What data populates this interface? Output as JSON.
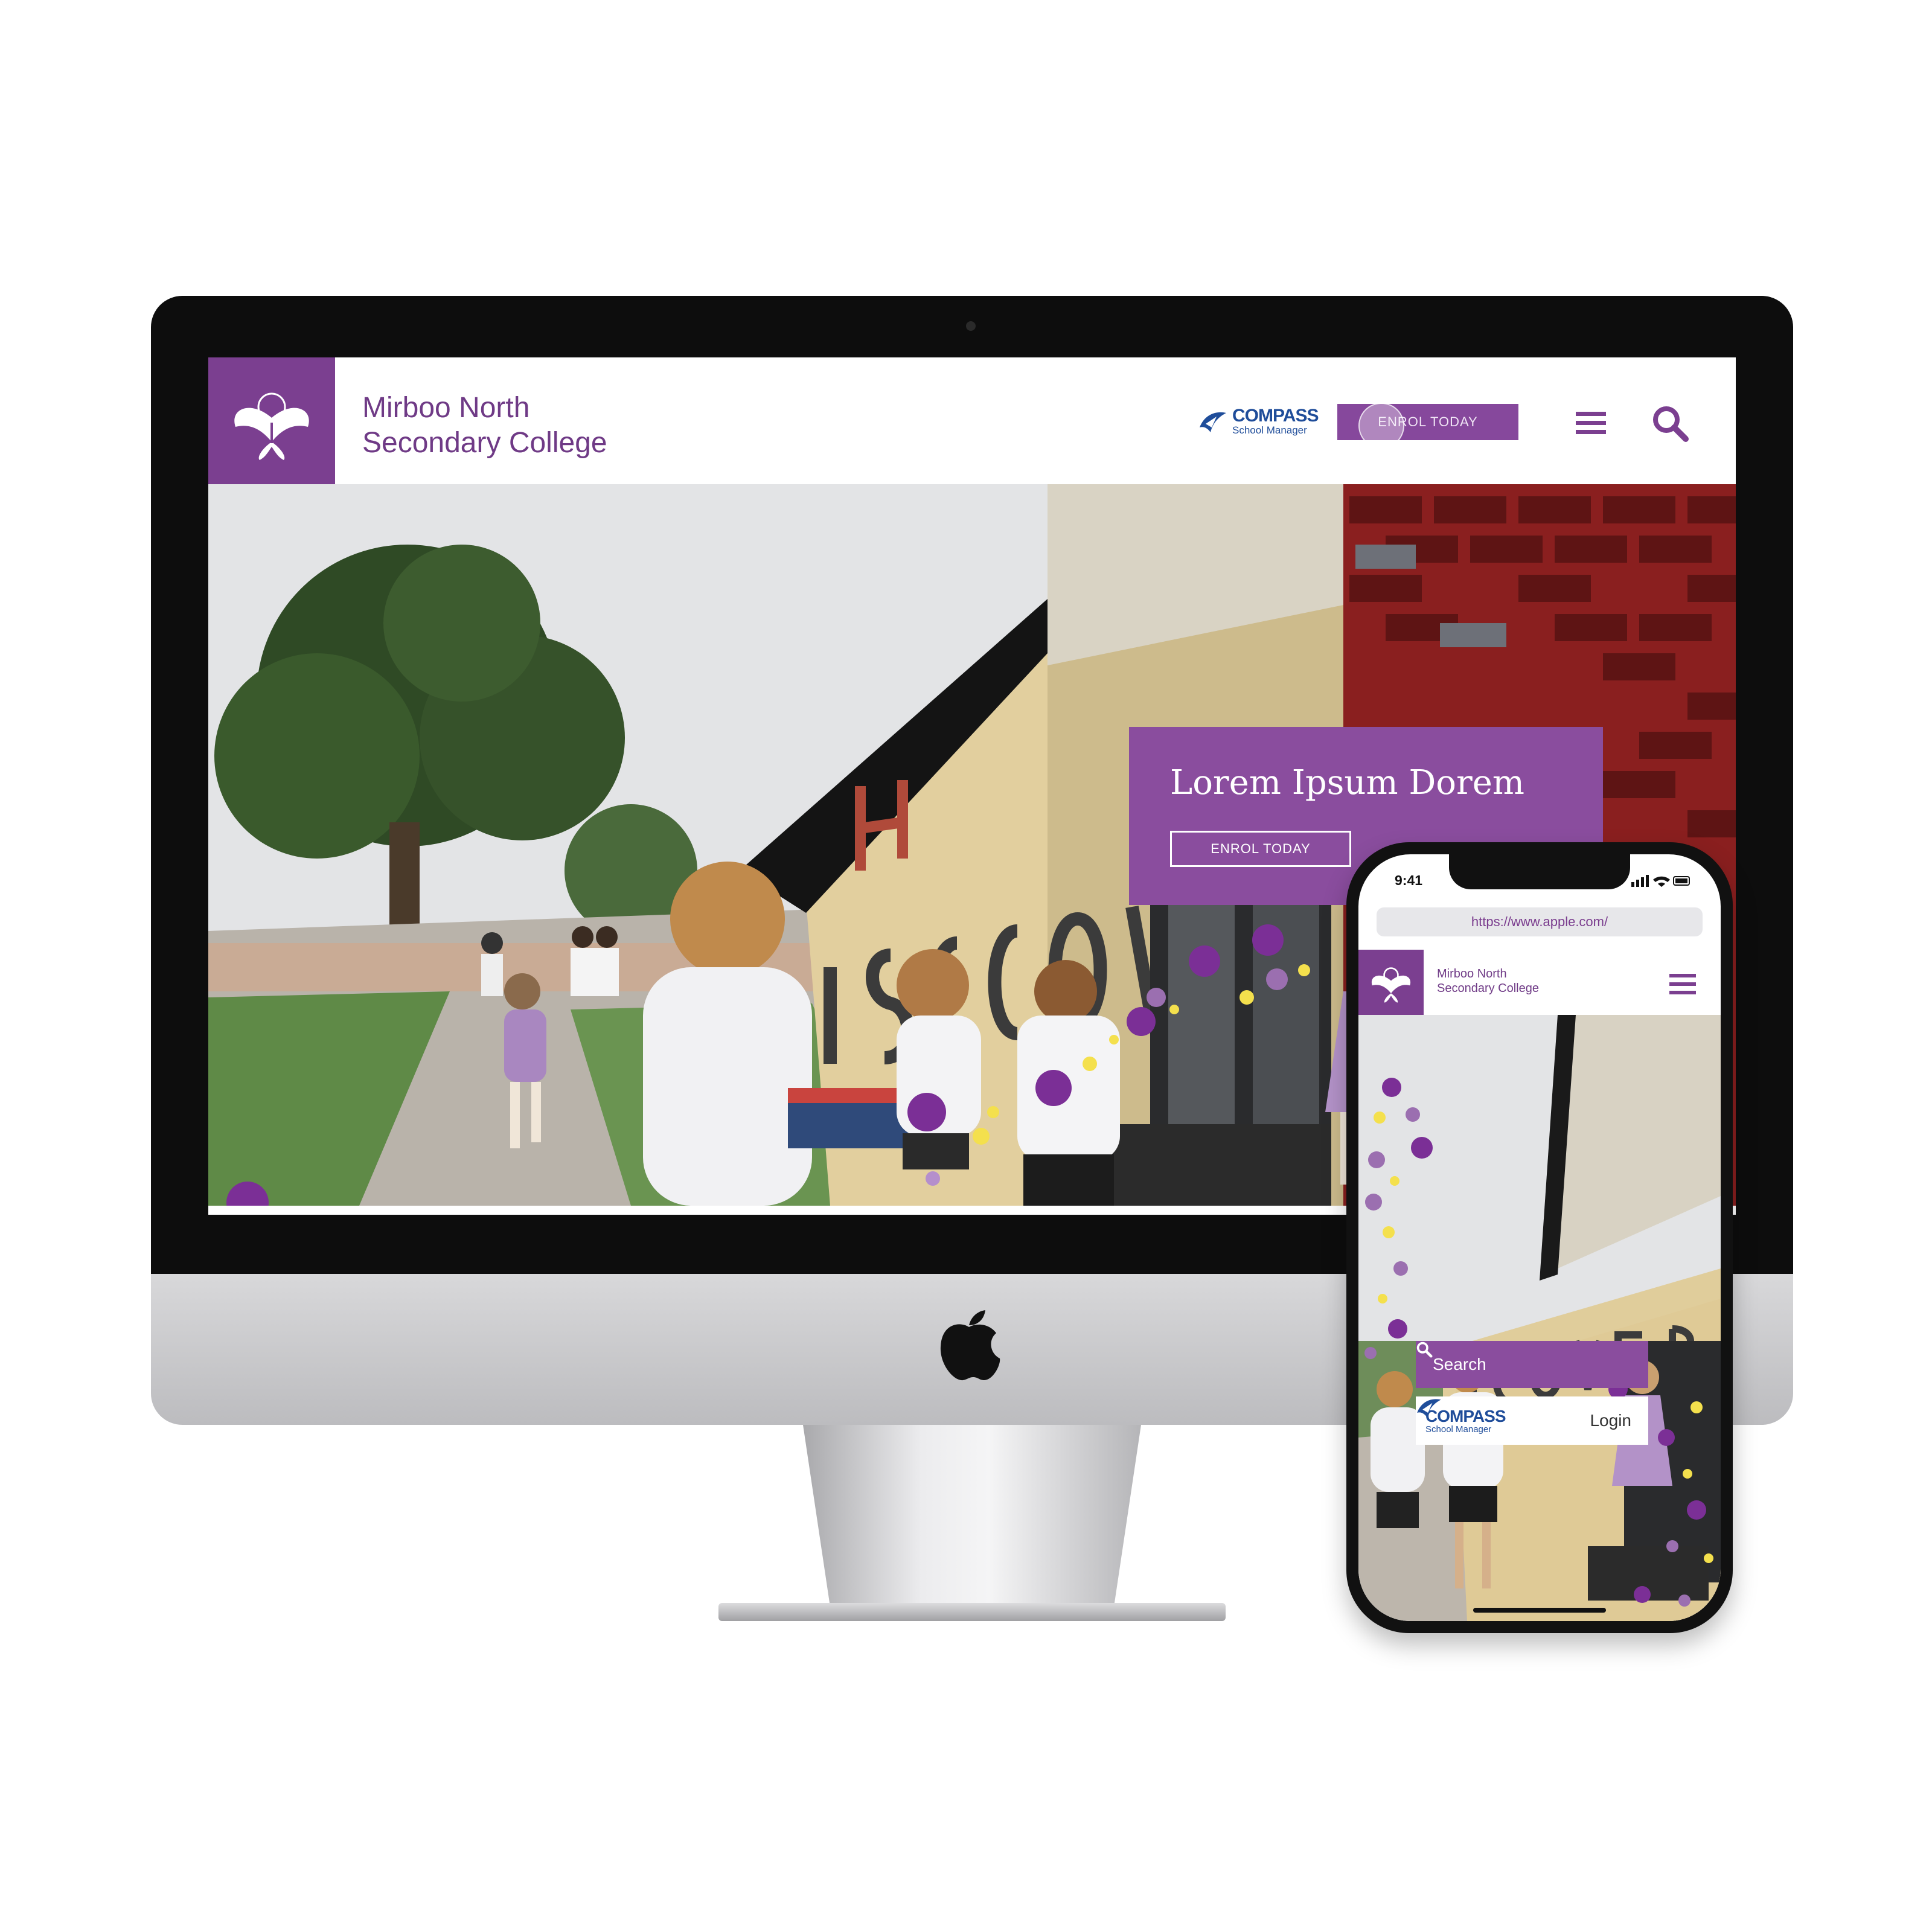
{
  "desktop": {
    "school_name_line1": "Mirboo North",
    "school_name_line2": "Secondary College",
    "compass": {
      "name": "COMPASS",
      "tagline": "School Manager"
    },
    "header_button": "ENROL TODAY",
    "menu_icon": "hamburger-menu-icon",
    "search_icon": "magnifier-icon",
    "hero": {
      "heading": "Lorem Ipsum Dorem",
      "button": "ENROL TODAY",
      "wall_letters": "DISCOVER"
    }
  },
  "mobile": {
    "status_time": "9:41",
    "url": "https://www.apple.com/",
    "school_name_line1": "Mirboo North",
    "school_name_line2": "Secondary College",
    "search_label": "Search",
    "compass": {
      "name": "COMPASS",
      "tagline": "School Manager"
    },
    "login_label": "Login"
  },
  "colors": {
    "brand_purple": "#7b3f90",
    "callout_purple": "#8a4d9e",
    "accent_yellow": "#f4e04d",
    "compass_blue": "#1f4d9a"
  }
}
